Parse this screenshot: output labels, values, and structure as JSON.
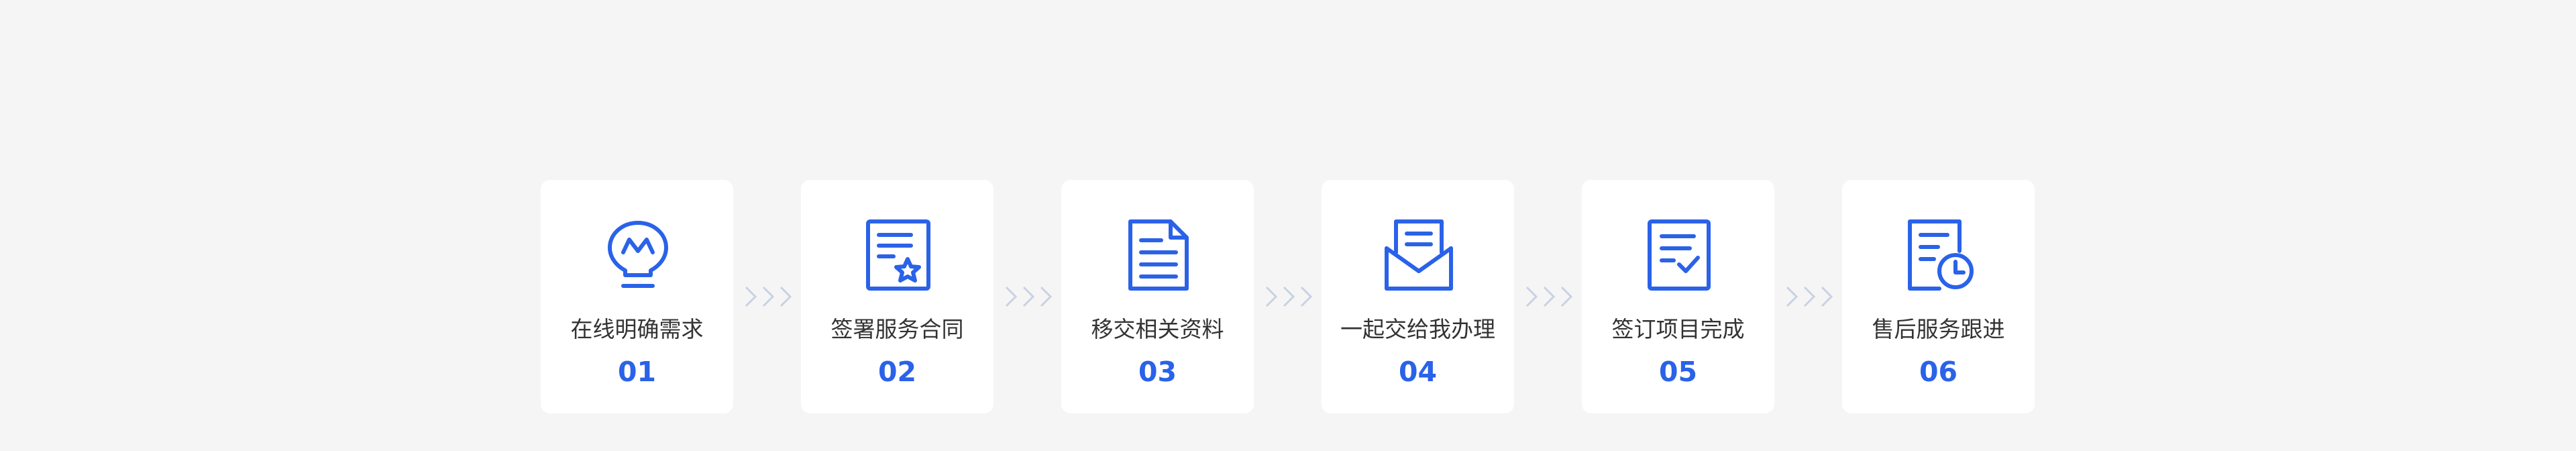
{
  "colors": {
    "background": "#f5f5f5",
    "card": "#ffffff",
    "accent": "#2a62e8",
    "label": "#333333",
    "arrow": "#c9d2e3"
  },
  "steps": [
    {
      "label": "在线明确需求",
      "number": "01",
      "icon": "lightbulb-icon"
    },
    {
      "label": "签署服务合同",
      "number": "02",
      "icon": "contract-star-icon"
    },
    {
      "label": "移交相关资料",
      "number": "03",
      "icon": "document-icon"
    },
    {
      "label": "一起交给我办理",
      "number": "04",
      "icon": "open-envelope-icon"
    },
    {
      "label": "签订项目完成",
      "number": "05",
      "icon": "document-check-icon"
    },
    {
      "label": "售后服务跟进",
      "number": "06",
      "icon": "document-clock-icon"
    }
  ]
}
